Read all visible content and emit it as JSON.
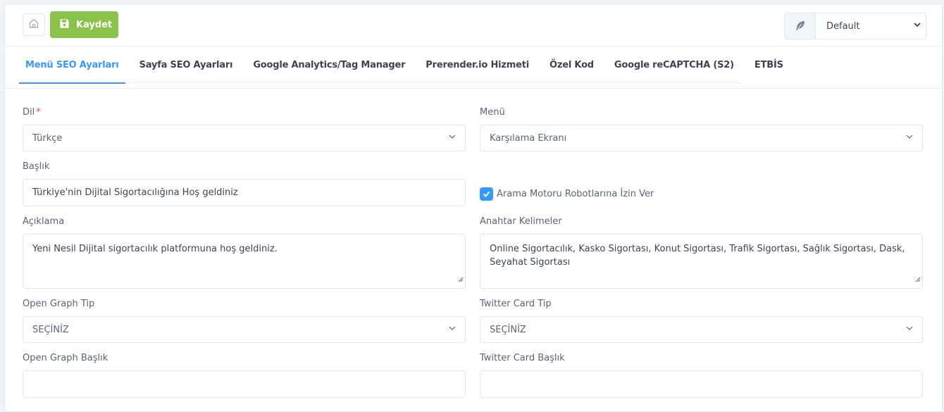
{
  "toolbar": {
    "home_icon": "home-icon",
    "save_icon": "save-icon",
    "save_label": "Kaydet",
    "theme_icon": "feather-icon",
    "theme_value": "Default"
  },
  "tabs": [
    {
      "label": "Menü SEO Ayarları",
      "active": true
    },
    {
      "label": "Sayfa SEO Ayarları",
      "active": false
    },
    {
      "label": "Google Analytics/Tag Manager",
      "active": false
    },
    {
      "label": "Prerender.io Hizmeti",
      "active": false
    },
    {
      "label": "Özel Kod",
      "active": false
    },
    {
      "label": "Google reCAPTCHA (S2)",
      "active": false
    },
    {
      "label": "ETBİS",
      "active": false
    }
  ],
  "form": {
    "dil": {
      "label": "Dil",
      "required_mark": "*",
      "value": "Türkçe"
    },
    "menu": {
      "label": "Menü",
      "value": "Karşılama Ekranı"
    },
    "baslik": {
      "label": "Başlık",
      "value": "Türkiye'nin Dijital Sigortacılığına Hoş geldiniz"
    },
    "robots": {
      "label": "Arama Motoru Robotlarına İzin Ver",
      "checked": true
    },
    "aciklama": {
      "label": "Açıklama",
      "value": "Yeni Nesil Dijital sigortacılık platformuna hoş geldiniz."
    },
    "anahtar": {
      "label": "Anahtar Kelimeler",
      "value": "Online Sigortacılık, Kasko Sigortası, Konut Sigortası, Trafik Sigortası, Sağlık Sigortası, Dask, Seyahat Sigortası"
    },
    "og_tip": {
      "label": "Open Graph Tip",
      "value": "SEÇİNİZ"
    },
    "tw_tip": {
      "label": "Twitter Card Tip",
      "value": "SEÇİNİZ"
    },
    "og_baslik": {
      "label": "Open Graph Başlık",
      "value": ""
    },
    "tw_baslik": {
      "label": "Twitter Card Başlık",
      "value": ""
    }
  },
  "colors": {
    "accent": "#3699ff",
    "save": "#8bc34a",
    "required": "#f64e60"
  }
}
